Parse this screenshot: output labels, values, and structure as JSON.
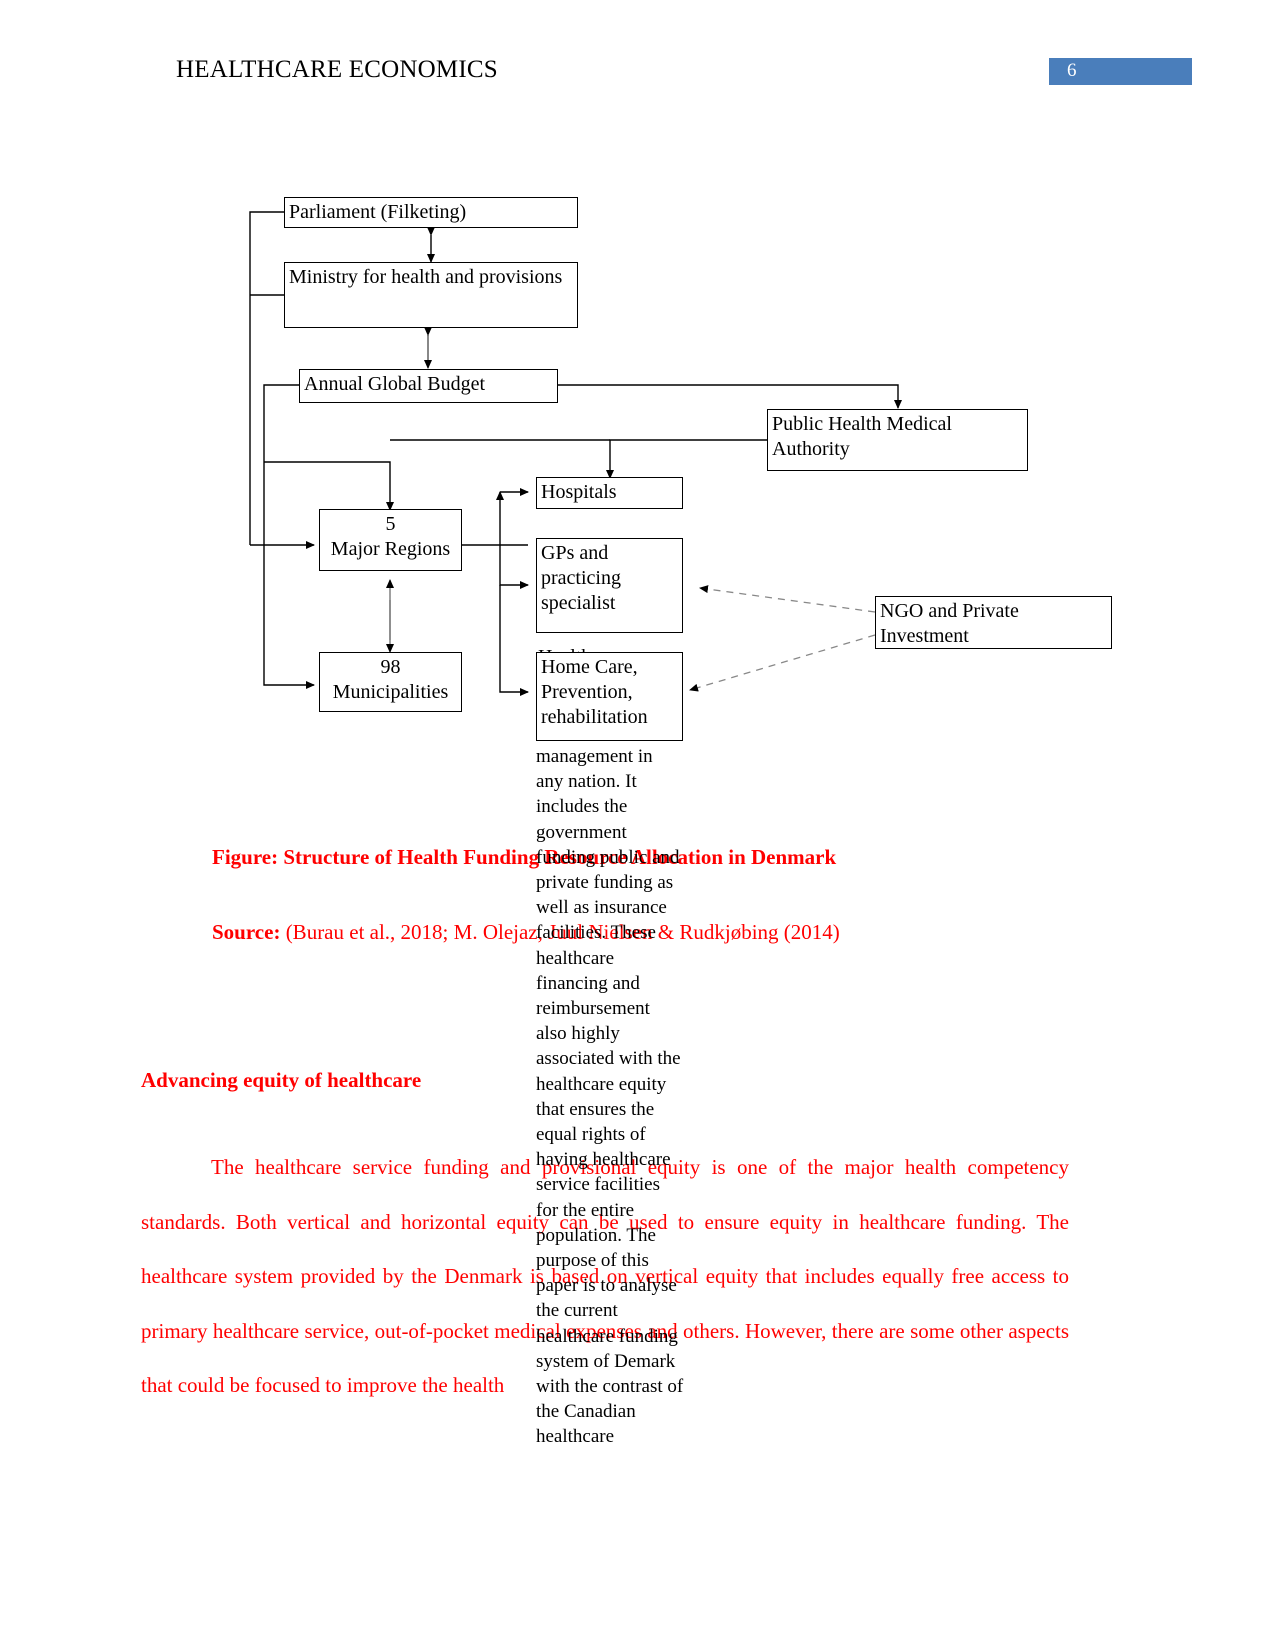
{
  "header": {
    "title": "HEALTHCARE ECONOMICS",
    "page_number": "6",
    "badge_color": "#4a7ebb"
  },
  "diagram": {
    "boxes": [
      {
        "id": "parliament",
        "label": "Parliament (Filketing)"
      },
      {
        "id": "ministry",
        "label": "Ministry for health and provisions"
      },
      {
        "id": "budget",
        "label": "Annual Global Budget"
      },
      {
        "id": "phma",
        "label": "Public Health Medical Authority"
      },
      {
        "id": "hospitals",
        "label": "Hospitals"
      },
      {
        "id": "gps",
        "label": "GPs and practicing specialist"
      },
      {
        "id": "homecare",
        "label": "Home Care, Prevention, rehabilitation"
      },
      {
        "id": "ngo",
        "label": "NGO and Private Investment"
      }
    ],
    "regions_box": {
      "number": "5",
      "label": "Major Regions"
    },
    "municipalities_box": {
      "number": "98",
      "label": "Municipalities"
    },
    "ghost_label": "Healthcare"
  },
  "caption": {
    "figure_prefix": "Figure:",
    "figure_text": " Structure of Health Funding Resource Allocation in Denmark",
    "source_prefix": "Source:",
    "source_text": " (Burau et al., 2018; M. Olejaz, Juul Nielsen & Rudkjøbing  (2014)"
  },
  "section": {
    "heading": "Advancing equity of healthcare",
    "paragraph": "The healthcare service funding and provisional equity is one of the major health competency standards. Both vertical and horizontal equity can be used to ensure equity in healthcare funding. The healthcare system provided by the Denmark is based on vertical equity that includes equally free access to primary healthcare service, out-of-pocket medical expenses and others. However, there are some other aspects that could be focused to improve the health"
  },
  "floating_column": {
    "text": "management in any nation. It includes the government funding public and private funding as well as insurance facilities. These healthcare financing and reimbursement also highly associated with the healthcare equity that ensures the equal rights of having healthcare service facilities for the entire population. The purpose of this paper is to analyse the current healthcare funding system of Demark with the contrast of the Canadian healthcare"
  },
  "colors": {
    "accent_red": "#ff0000",
    "badge_blue": "#4a7ebb",
    "line_black": "#000000"
  }
}
